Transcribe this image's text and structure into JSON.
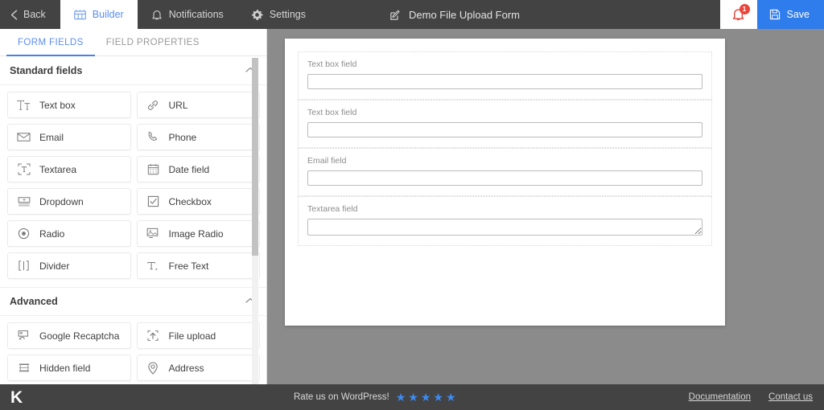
{
  "topbar": {
    "back_label": "Back",
    "tabs": [
      {
        "label": "Builder",
        "icon": "blocks-icon",
        "active": true
      },
      {
        "label": "Notifications",
        "icon": "bell-icon",
        "active": false
      },
      {
        "label": "Settings",
        "icon": "gear-icon",
        "active": false
      }
    ],
    "form_title": "Demo File Upload Form",
    "title_icon": "edit-pencil-icon",
    "notification_icon": "bell-alert-icon",
    "notification_count": "1",
    "save_label": "Save",
    "save_icon": "save-disk-icon",
    "colors": {
      "bar_bg": "#434343",
      "accent_blue": "#2f7ced",
      "badge_red": "#e8443a",
      "active_tab_text": "#5b8def"
    }
  },
  "sidebar": {
    "tabs": [
      {
        "label": "FORM FIELDS",
        "active": true
      },
      {
        "label": "FIELD PROPERTIES",
        "active": false
      }
    ],
    "sections": [
      {
        "title": "Standard fields",
        "collapse_icon": "chevron-up-icon",
        "fields": [
          {
            "label": "Text box",
            "icon": "text-box-icon"
          },
          {
            "label": "URL",
            "icon": "link-icon"
          },
          {
            "label": "Email",
            "icon": "envelope-icon"
          },
          {
            "label": "Phone",
            "icon": "phone-icon"
          },
          {
            "label": "Textarea",
            "icon": "textarea-icon"
          },
          {
            "label": "Date field",
            "icon": "calendar-icon"
          },
          {
            "label": "Dropdown",
            "icon": "dropdown-icon"
          },
          {
            "label": "Checkbox",
            "icon": "checkbox-icon"
          },
          {
            "label": "Radio",
            "icon": "radio-icon"
          },
          {
            "label": "Image Radio",
            "icon": "image-radio-icon"
          },
          {
            "label": "Divider",
            "icon": "divider-icon"
          },
          {
            "label": "Free Text",
            "icon": "free-text-icon"
          }
        ]
      },
      {
        "title": "Advanced",
        "collapse_icon": "chevron-up-icon",
        "fields": [
          {
            "label": "Google Recaptcha",
            "icon": "recaptcha-icon"
          },
          {
            "label": "File upload",
            "icon": "upload-icon"
          },
          {
            "label": "Hidden field",
            "icon": "hidden-field-icon"
          },
          {
            "label": "Address",
            "icon": "map-pin-icon"
          }
        ]
      }
    ]
  },
  "canvas": {
    "fields": [
      {
        "label": "Text box field",
        "type": "text",
        "value": ""
      },
      {
        "label": "Text box field",
        "type": "text",
        "value": ""
      },
      {
        "label": "Email field",
        "type": "email",
        "value": ""
      },
      {
        "label": "Textarea field",
        "type": "textarea",
        "value": ""
      }
    ]
  },
  "footer": {
    "logo": "K",
    "rate_text": "Rate us on WordPress!",
    "star_count": 5,
    "star_glyph": "★",
    "links": [
      {
        "label": "Documentation"
      },
      {
        "label": "Contact us"
      }
    ]
  }
}
